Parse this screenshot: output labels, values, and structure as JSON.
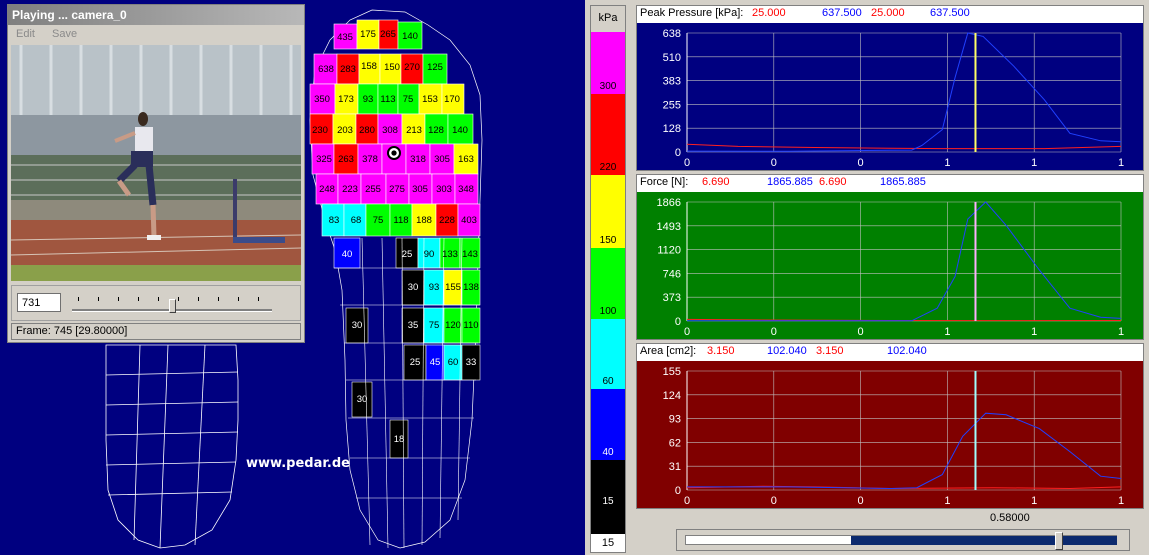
{
  "video": {
    "title": "Playing ... camera_0",
    "menu": [
      "Edit",
      "Save"
    ],
    "frame_input": "731",
    "status": "Frame:  745 [29.80000]",
    "slider_position": 0.52
  },
  "watermark": "www.pedar.de",
  "colorbar": {
    "unit": "kPa",
    "bottom_value": "15",
    "segments": [
      {
        "color": "#ff00ff",
        "label": "300"
      },
      {
        "color": "#ff0000",
        "label": "220"
      },
      {
        "color": "#ffff00",
        "label": "150"
      },
      {
        "color": "#00ff00",
        "label": "100"
      },
      {
        "color": "#00ffff",
        "label": "60"
      },
      {
        "color": "#0000ff",
        "label": "40"
      },
      {
        "color": "#000000",
        "label": "15"
      }
    ]
  },
  "graphs": [
    {
      "title": "Peak Pressure  [kPa]:",
      "values": [
        "25.000",
        "637.500",
        "25.000",
        "637.500"
      ],
      "value_colors": [
        "#ff0000",
        "#0000ff",
        "#ff0000",
        "#0000ff"
      ],
      "bg": "#000080",
      "cursor_color": "#ffff66",
      "y_ticks": [
        "638",
        "510",
        "383",
        "255",
        "128",
        "0"
      ],
      "x_ticks": [
        "0",
        "0",
        "0",
        "1",
        "1",
        "1"
      ],
      "ymax": 638,
      "blue": [
        [
          0,
          5
        ],
        [
          0.4,
          4
        ],
        [
          0.7,
          8
        ],
        [
          0.88,
          10
        ],
        [
          0.92,
          35
        ],
        [
          1.0,
          120
        ],
        [
          1.05,
          400
        ],
        [
          1.1,
          638
        ],
        [
          1.16,
          620
        ],
        [
          1.28,
          460
        ],
        [
          1.4,
          280
        ],
        [
          1.5,
          100
        ],
        [
          1.62,
          60
        ],
        [
          1.7,
          55
        ]
      ],
      "red": [
        [
          0,
          42
        ],
        [
          0.2,
          30
        ],
        [
          0.5,
          24
        ],
        [
          0.8,
          20
        ],
        [
          1.0,
          18
        ],
        [
          1.2,
          18
        ],
        [
          1.4,
          18
        ],
        [
          1.7,
          30
        ]
      ]
    },
    {
      "title": "Force [N]:",
      "values": [
        "6.690",
        "1865.885",
        "6.690",
        "1865.885"
      ],
      "value_colors": [
        "#ff0000",
        "#0000ff",
        "#ff0000",
        "#0000ff"
      ],
      "bg": "#008000",
      "cursor_color": "#ffb0ff",
      "y_ticks": [
        "1866",
        "1493",
        "1120",
        "746",
        "373",
        "0"
      ],
      "x_ticks": [
        "0",
        "0",
        "0",
        "1",
        "1",
        "1"
      ],
      "ymax": 1866,
      "blue": [
        [
          0,
          5
        ],
        [
          0.4,
          3
        ],
        [
          0.88,
          3
        ],
        [
          0.98,
          200
        ],
        [
          1.05,
          700
        ],
        [
          1.1,
          1600
        ],
        [
          1.17,
          1866
        ],
        [
          1.25,
          1500
        ],
        [
          1.38,
          800
        ],
        [
          1.5,
          200
        ],
        [
          1.62,
          60
        ],
        [
          1.7,
          40
        ]
      ],
      "red": [
        [
          0,
          25
        ],
        [
          0.3,
          15
        ],
        [
          0.8,
          8
        ],
        [
          1.2,
          6
        ],
        [
          1.7,
          8
        ]
      ]
    },
    {
      "title": "Area [cm2]:",
      "values": [
        "3.150",
        "102.040",
        "3.150",
        "102.040"
      ],
      "value_colors": [
        "#ff0000",
        "#0000ff",
        "#ff0000",
        "#0000ff"
      ],
      "bg": "#800000",
      "cursor_color": "#a0ffff",
      "y_ticks": [
        "155",
        "124",
        "93",
        "62",
        "31",
        "0"
      ],
      "x_ticks": [
        "0",
        "0",
        "0",
        "1",
        "1",
        "1"
      ],
      "ymax": 155,
      "blue": [
        [
          0,
          4
        ],
        [
          0.4,
          4
        ],
        [
          0.8,
          2
        ],
        [
          0.9,
          3
        ],
        [
          1.0,
          20
        ],
        [
          1.08,
          70
        ],
        [
          1.17,
          100
        ],
        [
          1.25,
          98
        ],
        [
          1.38,
          80
        ],
        [
          1.5,
          50
        ],
        [
          1.62,
          18
        ],
        [
          1.7,
          15
        ]
      ],
      "red": [
        [
          0,
          3
        ],
        [
          0.3,
          5
        ],
        [
          0.5,
          4
        ],
        [
          0.8,
          2
        ],
        [
          1.2,
          3
        ],
        [
          1.5,
          2
        ],
        [
          1.7,
          4
        ]
      ]
    }
  ],
  "cursor_x": 1.13,
  "bottom_value": "0.58000"
}
